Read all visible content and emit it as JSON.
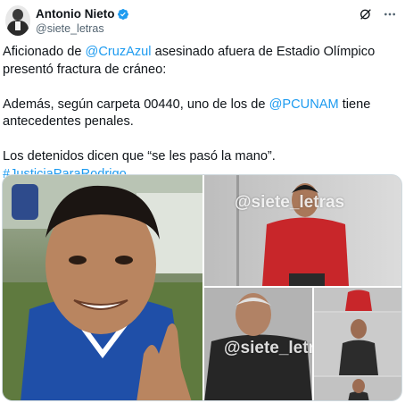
{
  "author": {
    "name": "Antonio Nieto",
    "handle": "@siete_letras"
  },
  "tweet": {
    "p1_a": "Aficionado de ",
    "p1_link": "@CruzAzul",
    "p1_b": " asesinado afuera de Estadio Olímpico presentó fractura de cráneo:",
    "p2_a": "Además, según carpeta 00440, uno de los de ",
    "p2_link": "@PCUNAM",
    "p2_b": " tiene antecedentes penales.",
    "p3_a": "Los detenidos dicen que “se les pasó la mano”. ",
    "p3_link": "#JusticiaParaRodrigo",
    "p3_b": "."
  },
  "media": {
    "watermark_top": "@siete_letras",
    "watermark_bottom": "@siete_letras"
  },
  "colors": {
    "link": "#1d9bf0",
    "verified": "#1d9bf0",
    "text": "#0f1419",
    "secondary": "#536471"
  },
  "icons": [
    "verified-badge-icon",
    "grok-icon",
    "more-options-icon"
  ]
}
